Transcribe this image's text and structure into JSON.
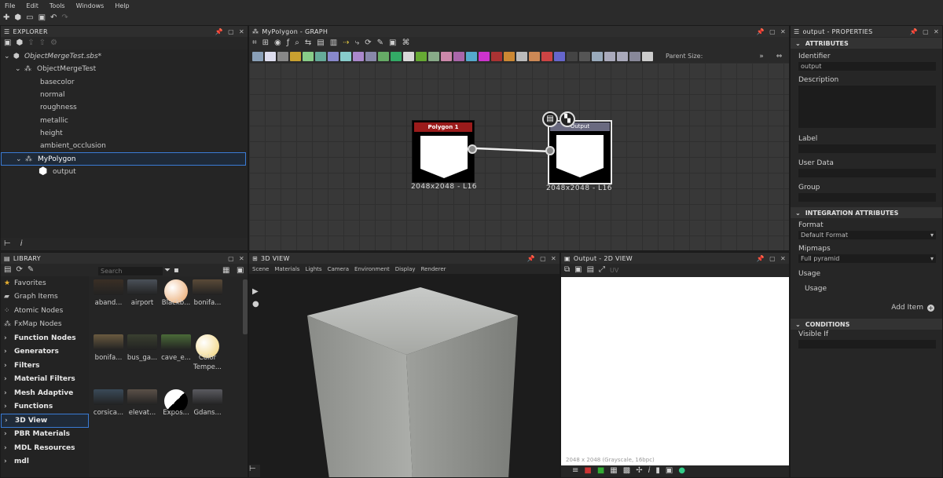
{
  "menu": [
    "File",
    "Edit",
    "Tools",
    "Windows",
    "Help"
  ],
  "explorer": {
    "title": "EXPLORER",
    "package": "ObjectMergeTest.sbs*",
    "graph1": "ObjectMergeTest",
    "outputs1": [
      "basecolor",
      "normal",
      "roughness",
      "metallic",
      "height",
      "ambient_occlusion"
    ],
    "graph2": "MyPolygon",
    "outputs2": [
      "output"
    ]
  },
  "graph": {
    "title": "MyPolygon - GRAPH",
    "parent_size_label": "Parent Size:",
    "node1": {
      "title": "Polygon 1",
      "caption": "2048x2048 - L16"
    },
    "node2": {
      "title": "Output",
      "caption": "2048x2048 - L16"
    }
  },
  "library": {
    "title": "LIBRARY",
    "search_placeholder": "Search",
    "categories": [
      {
        "label": "Favorites",
        "bold": false,
        "icon": "star-icon"
      },
      {
        "label": "Graph Items",
        "bold": false,
        "icon": "graph-items-icon"
      },
      {
        "label": "Atomic Nodes",
        "bold": false,
        "icon": "atomic-icon"
      },
      {
        "label": "FxMap Nodes",
        "bold": false,
        "icon": "fxmap-icon"
      },
      {
        "label": "Function Nodes",
        "bold": true,
        "icon": "chevron-right-icon"
      },
      {
        "label": "Generators",
        "bold": true,
        "icon": "chevron-right-icon"
      },
      {
        "label": "Filters",
        "bold": true,
        "icon": "chevron-right-icon"
      },
      {
        "label": "Material Filters",
        "bold": true,
        "icon": "chevron-right-icon"
      },
      {
        "label": "Mesh Adaptive",
        "bold": true,
        "icon": "chevron-right-icon"
      },
      {
        "label": "Functions",
        "bold": true,
        "icon": "chevron-right-icon"
      },
      {
        "label": "3D View",
        "bold": true,
        "icon": "chevron-right-icon"
      },
      {
        "label": "PBR Materials",
        "bold": true,
        "icon": "chevron-right-icon"
      },
      {
        "label": "MDL Resources",
        "bold": true,
        "icon": "chevron-right-icon"
      },
      {
        "label": "mdl",
        "bold": true,
        "icon": "chevron-right-icon"
      }
    ],
    "items": [
      {
        "label": "aband...",
        "color": "#3a2f25"
      },
      {
        "label": "airport",
        "color": "#4a5058"
      },
      {
        "label": "Blackb...",
        "color": "#e8a060"
      },
      {
        "label": "bonifa...",
        "color": "#5a4a38"
      },
      {
        "label": "bonifa...",
        "color": "#6a5a40"
      },
      {
        "label": "bus_ga...",
        "color": "#3a4030"
      },
      {
        "label": "cave_e...",
        "color": "#4a6a38"
      },
      {
        "label": "Color Tempe...",
        "color": "#f0d070"
      },
      {
        "label": "corsica...",
        "color": "#3a4a58"
      },
      {
        "label": "elevat...",
        "color": "#5a5048"
      },
      {
        "label": "Expos...",
        "color": "#1a1a1a"
      },
      {
        "label": "Gdans...",
        "color": "#5a5a60"
      }
    ]
  },
  "view3d": {
    "title": "3D VIEW",
    "menu": [
      "Scene",
      "Materials",
      "Lights",
      "Camera",
      "Environment",
      "Display",
      "Renderer"
    ]
  },
  "view2d": {
    "title": "Output - 2D VIEW",
    "uv_label": "UV",
    "status": "2048 x 2048 (Grayscale, 16bpc)"
  },
  "properties": {
    "title": "output - PROPERTIES",
    "attributes_header": "ATTRIBUTES",
    "identifier_label": "Identifier",
    "identifier_value": "output",
    "description_label": "Description",
    "label_label": "Label",
    "userdata_label": "User Data",
    "group_label": "Group",
    "integration_header": "INTEGRATION ATTRIBUTES",
    "format_label": "Format",
    "format_value": "Default Format",
    "mipmaps_label": "Mipmaps",
    "mipmaps_value": "Full pyramid",
    "usage_label": "Usage",
    "usage_item": "Usage",
    "add_item_label": "Add Item",
    "conditions_header": "CONDITIONS",
    "visible_if_label": "Visible If"
  },
  "colors": {
    "node1_header": "#9b1b1b",
    "node2_header": "#6a6a80",
    "selection": "#3a7bd5"
  }
}
